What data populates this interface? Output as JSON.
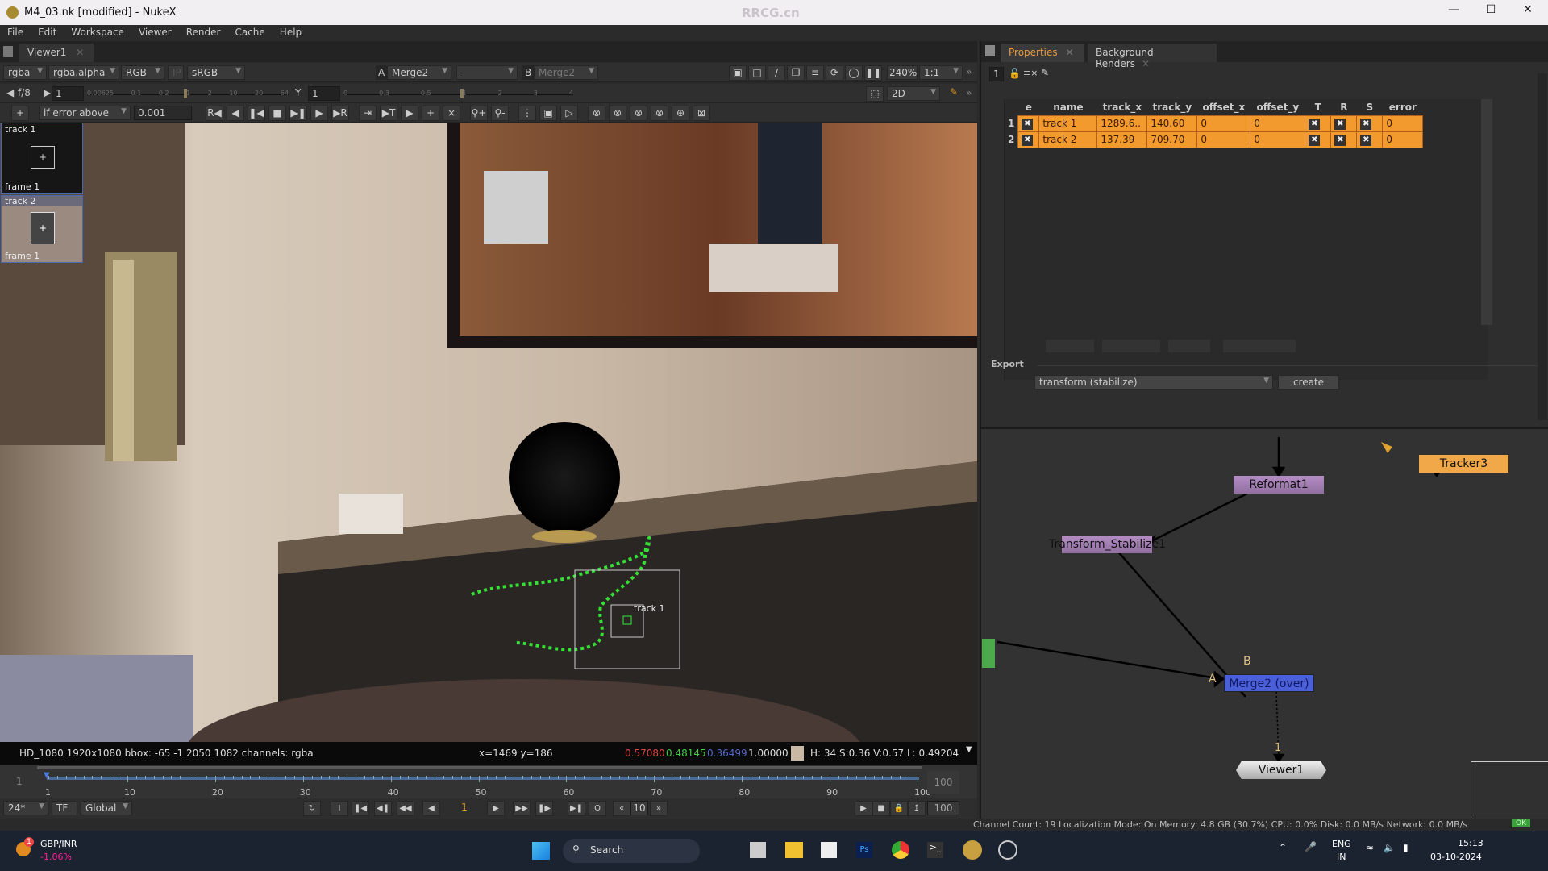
{
  "window": {
    "title": "M4_03.nk [modified] - NukeX",
    "watermark": "RRCG.cn",
    "controls": [
      "minimize",
      "maximize",
      "close"
    ]
  },
  "menu": [
    "File",
    "Edit",
    "Workspace",
    "Viewer",
    "Render",
    "Cache",
    "Help"
  ],
  "viewer": {
    "tab": "Viewer1",
    "channels": "rgba",
    "alpha": "rgba.alpha",
    "display": "RGB",
    "ip": "IP",
    "colorspace": "sRGB",
    "input_a_label": "A",
    "input_a": "Merge2",
    "wipe": "-",
    "input_b_label": "B",
    "input_b": "Merge2",
    "zoom": "240%",
    "ratio": "1:1",
    "fstop": "f/8",
    "gain": "1",
    "gamma_label": "Y",
    "gamma": "1",
    "gain_ticks": [
      "0.00625",
      "0.1",
      "0.2",
      "1",
      "2",
      "10",
      "20",
      "64"
    ],
    "gamma_ticks": [
      "0",
      "0.3",
      "0.5",
      "1",
      "2",
      "3",
      "4"
    ],
    "view_mode": "2D",
    "tracker_toolbar": {
      "mode": "if error above",
      "threshold": "0.001"
    },
    "thumbnails": [
      {
        "track": "track 1",
        "frame": "frame 1"
      },
      {
        "track": "track 2",
        "frame": "frame 1"
      }
    ],
    "track_label": "track 1",
    "info": {
      "format": "HD_1080 1920x1080  bbox: -65 -1 2050 1082 channels: rgba",
      "coords": "x=1469 y=186",
      "r": "0.57080",
      "g": "0.48145",
      "b": "0.36499",
      "a": "1.00000",
      "swatch": "#c9b9a4",
      "hsvl": "H: 34 S:0.36 V:0.57  L: 0.49204"
    }
  },
  "timeline": {
    "start": "1",
    "end": "100",
    "ticks": [
      "1",
      "10",
      "20",
      "30",
      "40",
      "50",
      "60",
      "70",
      "80",
      "90",
      "100"
    ],
    "fps": "24*",
    "tf": "TF",
    "scope": "Global",
    "current_frame": "1",
    "step": "10",
    "out": "100"
  },
  "properties": {
    "tabs": [
      {
        "label": "Properties",
        "active": true
      },
      {
        "label": "Background Renders",
        "active": false
      }
    ],
    "count": "1",
    "columns": [
      "e",
      "name",
      "track_x",
      "track_y",
      "offset_x",
      "offset_y",
      "T",
      "R",
      "S",
      "error"
    ],
    "rows": [
      {
        "index": "1",
        "e": true,
        "name": "track 1",
        "track_x": "1289.6..",
        "track_y": "140.60",
        "offset_x": "0",
        "offset_y": "0",
        "T": true,
        "R": true,
        "S": true,
        "error": "0"
      },
      {
        "index": "2",
        "e": true,
        "name": "track 2",
        "track_x": "137.39",
        "track_y": "709.70",
        "offset_x": "0",
        "offset_y": "0",
        "T": true,
        "R": true,
        "S": true,
        "error": "0"
      }
    ],
    "export_label": "Export",
    "export_dropdown": "transform (stabilize)",
    "export_button": "create"
  },
  "nodegraph": {
    "nodes": [
      {
        "name": "Reformat1",
        "color": "#a57fb5"
      },
      {
        "name": "Tracker3",
        "color": "#f0a848"
      },
      {
        "name": "Transform_Stabilize1",
        "color": "#a57fb5"
      },
      {
        "name": "Merge2 (over)",
        "color": "#4a5fd8"
      },
      {
        "name": "Viewer1",
        "color": "#c8c8c8"
      }
    ],
    "input_labels": {
      "a": "A",
      "b": "B",
      "viewer": "1"
    }
  },
  "status": {
    "text": "Channel Count: 19  Localization Mode: On  Memory: 4.8 GB (30.7%)  CPU: 0.0%  Disk: 0.0 MB/s  Network: 0.0 MB/s",
    "ok": "OK"
  },
  "taskbar": {
    "ticker": "GBP/INR",
    "ticker_change": "-1.06%",
    "badge": "1",
    "search": "Search",
    "lang": "ENG",
    "region": "IN",
    "time": "15:13",
    "date": "03-10-2024"
  }
}
